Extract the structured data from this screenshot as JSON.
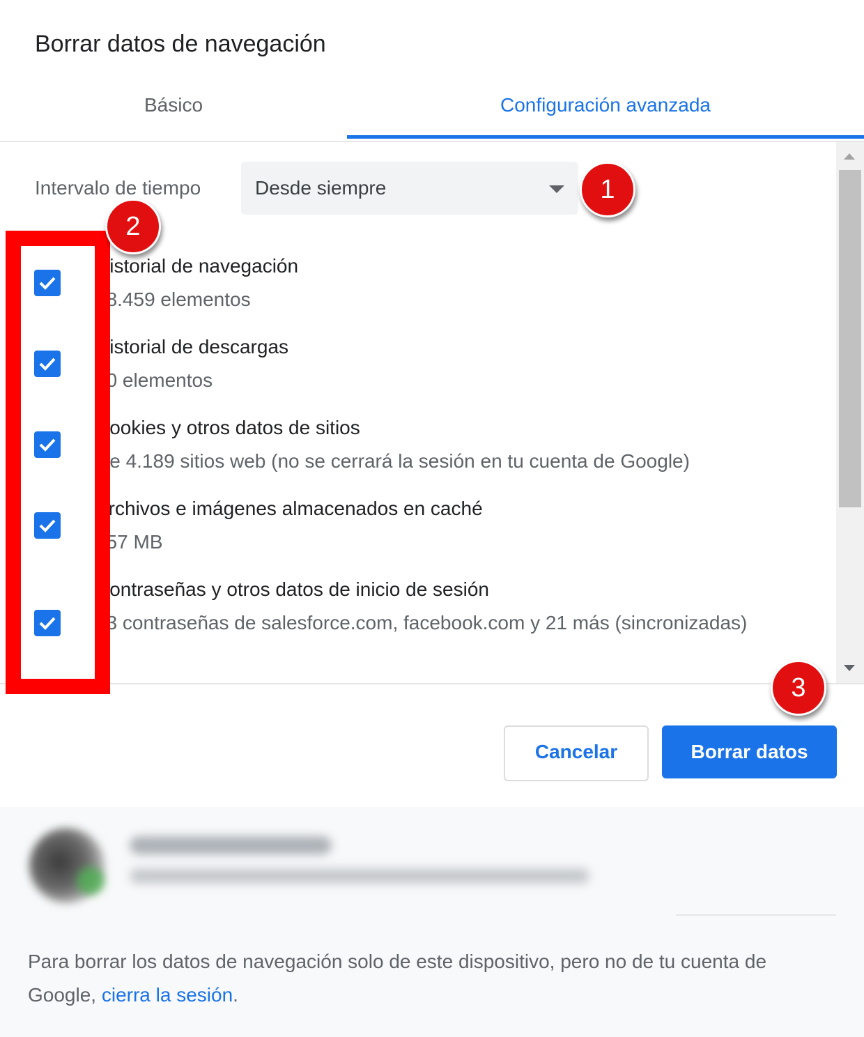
{
  "dialog": {
    "title": "Borrar datos de navegación"
  },
  "tabs": [
    {
      "label": "Básico",
      "active": false
    },
    {
      "label": "Configuración avanzada",
      "active": true
    }
  ],
  "time_range": {
    "label": "Intervalo de tiempo",
    "selected": "Desde siempre"
  },
  "items": [
    {
      "title": "Historial de navegación",
      "subtitle": "28.459 elementos",
      "checked": true
    },
    {
      "title": "Historial de descargas",
      "subtitle": "40 elementos",
      "checked": true
    },
    {
      "title": "Cookies y otros datos de sitios",
      "subtitle": "De 4.189 sitios web (no se cerrará la sesión en tu cuenta de Google)",
      "checked": true
    },
    {
      "title": "Archivos e imágenes almacenados en caché",
      "subtitle": "257 MB",
      "checked": true
    },
    {
      "title": "Contraseñas y otros datos de inicio de sesión",
      "subtitle": "23 contraseñas de salesforce.com, facebook.com y 21 más (sincronizadas)",
      "checked": true
    }
  ],
  "markers": [
    "1",
    "2",
    "3"
  ],
  "buttons": {
    "cancel": "Cancelar",
    "clear": "Borrar datos"
  },
  "footer": {
    "text_before": "Para borrar los datos de navegación solo de este dispositivo, pero no de tu cuenta de Google, ",
    "link": "cierra la sesión",
    "text_after": "."
  },
  "colors": {
    "accent": "#1a73e8",
    "highlight": "#ff0000",
    "marker": "#e20f10"
  }
}
